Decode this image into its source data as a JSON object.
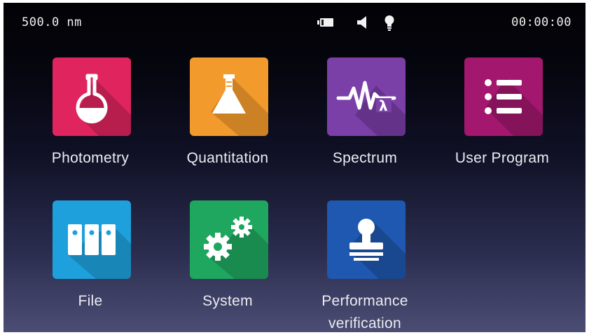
{
  "status_bar": {
    "wavelength": "500.0 nm",
    "clock": "00:00:00",
    "icons": [
      "battery-icon",
      "speaker-icon",
      "lamp-icon"
    ]
  },
  "apps": [
    {
      "label": "Photometry",
      "icon": "flask-icon",
      "color": "#e0245e"
    },
    {
      "label": "Quantitation",
      "icon": "erlenmeyer-flask-icon",
      "color": "#f39a2c"
    },
    {
      "label": "Spectrum",
      "icon": "spectrum-wave-icon",
      "color": "#7b3fa8"
    },
    {
      "label": "User Program",
      "icon": "list-icon",
      "color": "#a3186e"
    },
    {
      "label": "File",
      "icon": "file-binders-icon",
      "color": "#1ea0dc"
    },
    {
      "label": "System",
      "icon": "gears-icon",
      "color": "#1fa65f"
    },
    {
      "label": "Performance\nverification",
      "label_line1": "Performance",
      "label_line2": "verification",
      "icon": "stamp-icon",
      "color": "#1f58b0"
    }
  ]
}
